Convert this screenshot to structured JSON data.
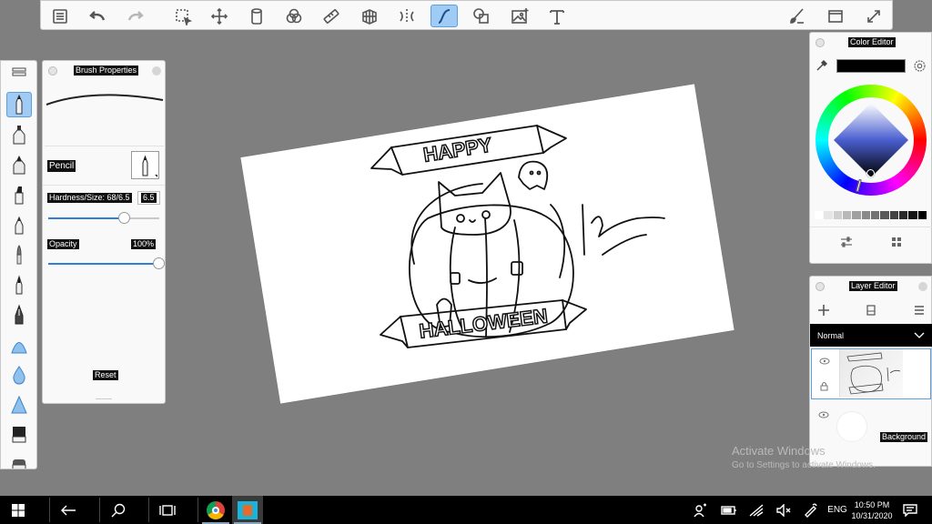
{
  "brush_properties": {
    "title": "Brush Properties",
    "brush_name": "Pencil",
    "hardness_size_label": "Hardness/Size: 68/6.5",
    "size_value": "6.5",
    "size_level": 0.78,
    "opacity_label": "Opacity",
    "opacity_value": "100%",
    "opacity_level": 1.0,
    "reset_label": "Reset"
  },
  "color_editor": {
    "title": "Color Editor",
    "current_color": "#000000",
    "swatches": [
      "#ffffff",
      "#e6e6e6",
      "#cfcfcf",
      "#b8b8b8",
      "#a0a0a0",
      "#898989",
      "#727272",
      "#5a5a5a",
      "#434343",
      "#2b2b2b",
      "#141414",
      "#000000"
    ]
  },
  "layer_editor": {
    "title": "Layer Editor",
    "blend_mode": "Normal",
    "layers": [
      {
        "name": ""
      },
      {
        "name": "Background"
      }
    ]
  },
  "artwork": {
    "banner_top": "HAPPY",
    "banner_bottom": "HALLOWEEN"
  },
  "watermark": {
    "line1": "Activate Windows",
    "line2": "Go to Settings to activate Windows."
  },
  "taskbar": {
    "language": "ENG",
    "time": "10:50 PM",
    "date": "10/31/2020"
  },
  "colors": {
    "accent": "#2f7fd8",
    "active_tool": "#9fcbf5",
    "workspace": "#7f7f7f"
  }
}
